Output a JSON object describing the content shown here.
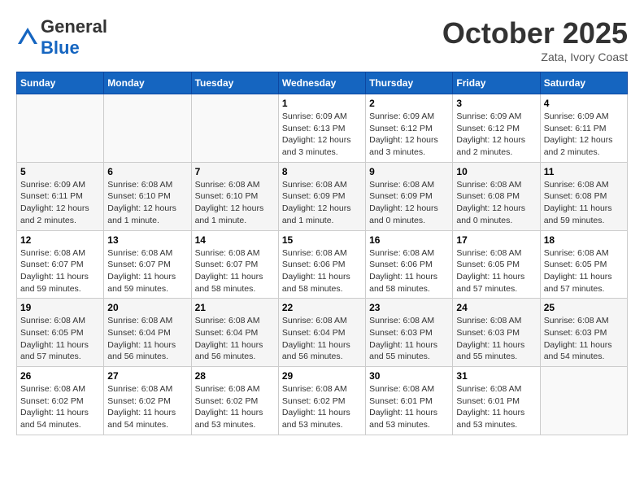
{
  "logo": {
    "general": "General",
    "blue": "Blue"
  },
  "header": {
    "month": "October 2025",
    "location": "Zata, Ivory Coast"
  },
  "weekdays": [
    "Sunday",
    "Monday",
    "Tuesday",
    "Wednesday",
    "Thursday",
    "Friday",
    "Saturday"
  ],
  "weeks": [
    [
      {
        "day": "",
        "sunrise": "",
        "sunset": "",
        "daylight": ""
      },
      {
        "day": "",
        "sunrise": "",
        "sunset": "",
        "daylight": ""
      },
      {
        "day": "",
        "sunrise": "",
        "sunset": "",
        "daylight": ""
      },
      {
        "day": "1",
        "sunrise": "Sunrise: 6:09 AM",
        "sunset": "Sunset: 6:13 PM",
        "daylight": "Daylight: 12 hours and 3 minutes."
      },
      {
        "day": "2",
        "sunrise": "Sunrise: 6:09 AM",
        "sunset": "Sunset: 6:12 PM",
        "daylight": "Daylight: 12 hours and 3 minutes."
      },
      {
        "day": "3",
        "sunrise": "Sunrise: 6:09 AM",
        "sunset": "Sunset: 6:12 PM",
        "daylight": "Daylight: 12 hours and 2 minutes."
      },
      {
        "day": "4",
        "sunrise": "Sunrise: 6:09 AM",
        "sunset": "Sunset: 6:11 PM",
        "daylight": "Daylight: 12 hours and 2 minutes."
      }
    ],
    [
      {
        "day": "5",
        "sunrise": "Sunrise: 6:09 AM",
        "sunset": "Sunset: 6:11 PM",
        "daylight": "Daylight: 12 hours and 2 minutes."
      },
      {
        "day": "6",
        "sunrise": "Sunrise: 6:08 AM",
        "sunset": "Sunset: 6:10 PM",
        "daylight": "Daylight: 12 hours and 1 minute."
      },
      {
        "day": "7",
        "sunrise": "Sunrise: 6:08 AM",
        "sunset": "Sunset: 6:10 PM",
        "daylight": "Daylight: 12 hours and 1 minute."
      },
      {
        "day": "8",
        "sunrise": "Sunrise: 6:08 AM",
        "sunset": "Sunset: 6:09 PM",
        "daylight": "Daylight: 12 hours and 1 minute."
      },
      {
        "day": "9",
        "sunrise": "Sunrise: 6:08 AM",
        "sunset": "Sunset: 6:09 PM",
        "daylight": "Daylight: 12 hours and 0 minutes."
      },
      {
        "day": "10",
        "sunrise": "Sunrise: 6:08 AM",
        "sunset": "Sunset: 6:08 PM",
        "daylight": "Daylight: 12 hours and 0 minutes."
      },
      {
        "day": "11",
        "sunrise": "Sunrise: 6:08 AM",
        "sunset": "Sunset: 6:08 PM",
        "daylight": "Daylight: 11 hours and 59 minutes."
      }
    ],
    [
      {
        "day": "12",
        "sunrise": "Sunrise: 6:08 AM",
        "sunset": "Sunset: 6:07 PM",
        "daylight": "Daylight: 11 hours and 59 minutes."
      },
      {
        "day": "13",
        "sunrise": "Sunrise: 6:08 AM",
        "sunset": "Sunset: 6:07 PM",
        "daylight": "Daylight: 11 hours and 59 minutes."
      },
      {
        "day": "14",
        "sunrise": "Sunrise: 6:08 AM",
        "sunset": "Sunset: 6:07 PM",
        "daylight": "Daylight: 11 hours and 58 minutes."
      },
      {
        "day": "15",
        "sunrise": "Sunrise: 6:08 AM",
        "sunset": "Sunset: 6:06 PM",
        "daylight": "Daylight: 11 hours and 58 minutes."
      },
      {
        "day": "16",
        "sunrise": "Sunrise: 6:08 AM",
        "sunset": "Sunset: 6:06 PM",
        "daylight": "Daylight: 11 hours and 58 minutes."
      },
      {
        "day": "17",
        "sunrise": "Sunrise: 6:08 AM",
        "sunset": "Sunset: 6:05 PM",
        "daylight": "Daylight: 11 hours and 57 minutes."
      },
      {
        "day": "18",
        "sunrise": "Sunrise: 6:08 AM",
        "sunset": "Sunset: 6:05 PM",
        "daylight": "Daylight: 11 hours and 57 minutes."
      }
    ],
    [
      {
        "day": "19",
        "sunrise": "Sunrise: 6:08 AM",
        "sunset": "Sunset: 6:05 PM",
        "daylight": "Daylight: 11 hours and 57 minutes."
      },
      {
        "day": "20",
        "sunrise": "Sunrise: 6:08 AM",
        "sunset": "Sunset: 6:04 PM",
        "daylight": "Daylight: 11 hours and 56 minutes."
      },
      {
        "day": "21",
        "sunrise": "Sunrise: 6:08 AM",
        "sunset": "Sunset: 6:04 PM",
        "daylight": "Daylight: 11 hours and 56 minutes."
      },
      {
        "day": "22",
        "sunrise": "Sunrise: 6:08 AM",
        "sunset": "Sunset: 6:04 PM",
        "daylight": "Daylight: 11 hours and 56 minutes."
      },
      {
        "day": "23",
        "sunrise": "Sunrise: 6:08 AM",
        "sunset": "Sunset: 6:03 PM",
        "daylight": "Daylight: 11 hours and 55 minutes."
      },
      {
        "day": "24",
        "sunrise": "Sunrise: 6:08 AM",
        "sunset": "Sunset: 6:03 PM",
        "daylight": "Daylight: 11 hours and 55 minutes."
      },
      {
        "day": "25",
        "sunrise": "Sunrise: 6:08 AM",
        "sunset": "Sunset: 6:03 PM",
        "daylight": "Daylight: 11 hours and 54 minutes."
      }
    ],
    [
      {
        "day": "26",
        "sunrise": "Sunrise: 6:08 AM",
        "sunset": "Sunset: 6:02 PM",
        "daylight": "Daylight: 11 hours and 54 minutes."
      },
      {
        "day": "27",
        "sunrise": "Sunrise: 6:08 AM",
        "sunset": "Sunset: 6:02 PM",
        "daylight": "Daylight: 11 hours and 54 minutes."
      },
      {
        "day": "28",
        "sunrise": "Sunrise: 6:08 AM",
        "sunset": "Sunset: 6:02 PM",
        "daylight": "Daylight: 11 hours and 53 minutes."
      },
      {
        "day": "29",
        "sunrise": "Sunrise: 6:08 AM",
        "sunset": "Sunset: 6:02 PM",
        "daylight": "Daylight: 11 hours and 53 minutes."
      },
      {
        "day": "30",
        "sunrise": "Sunrise: 6:08 AM",
        "sunset": "Sunset: 6:01 PM",
        "daylight": "Daylight: 11 hours and 53 minutes."
      },
      {
        "day": "31",
        "sunrise": "Sunrise: 6:08 AM",
        "sunset": "Sunset: 6:01 PM",
        "daylight": "Daylight: 11 hours and 53 minutes."
      },
      {
        "day": "",
        "sunrise": "",
        "sunset": "",
        "daylight": ""
      }
    ]
  ]
}
